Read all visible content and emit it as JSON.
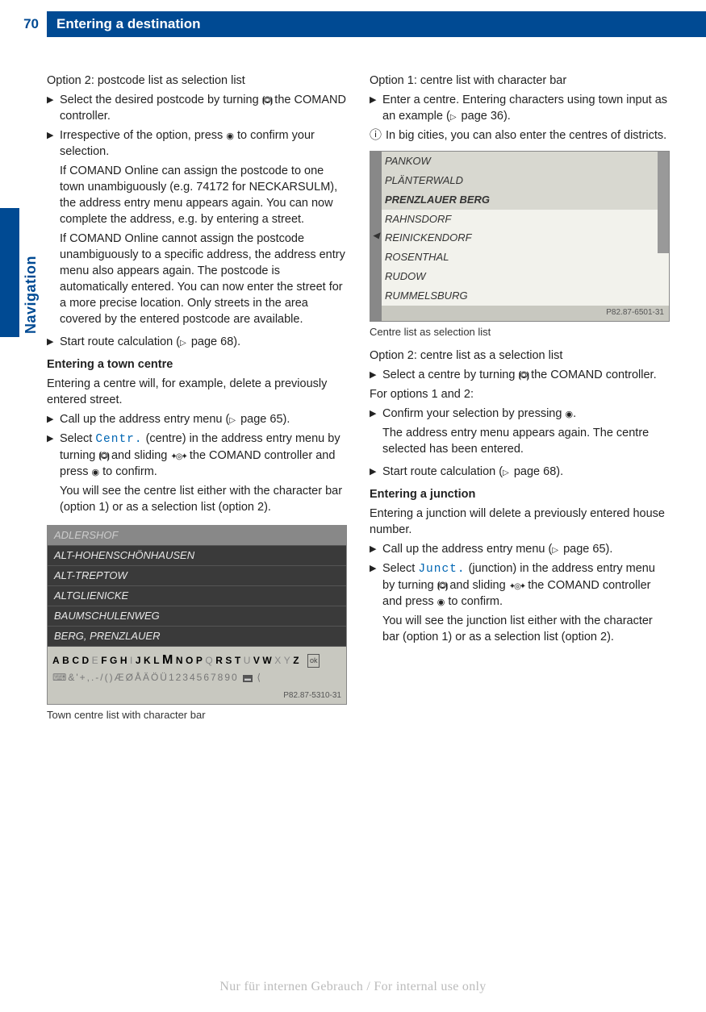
{
  "page_number": "70",
  "chapter": "Entering a destination",
  "side_label": "Navigation",
  "left": {
    "p1": "Option 2: postcode list as selection list",
    "s1": "Select the desired postcode by turning ",
    "s1b": " the COMAND controller.",
    "s2a": "Irrespective of the option, press ",
    "s2b": " to confirm your selection.",
    "s2c": "If COMAND Online can assign the postcode to one town unambiguously (e.g. 74172 for NECKARSULM), the address entry menu appears again. You can now complete the address, e.g. by entering a street.",
    "s2d": "If COMAND Online cannot assign the postcode unambiguously to a specific address, the address entry menu also appears again. The postcode is automatically entered. You can now enter the street for a more precise location. Only streets in the area covered by the entered postcode are available.",
    "s3": "Start route calculation (",
    "s3b": " page 68).",
    "h1": "Entering a town centre",
    "p2": "Entering a centre will, for example, delete a previously entered street.",
    "s4": "Call up the address entry menu (",
    "s4b": " page 65).",
    "s5a": "Select ",
    "s5menu": "Centr.",
    "s5b": " (centre) in the address entry menu by turning ",
    "s5c": " and sliding ",
    "s5d": " the COMAND controller and press ",
    "s5e": " to confirm.",
    "s5f": "You will see the centre list either with the character bar (option 1) or as a selection list (option 2).",
    "fig1": {
      "rows": [
        "ADLERSHOF",
        "ALT-HOHENSCHÖNHAUSEN",
        "ALT-TREPTOW",
        "ALTGLIENICKE",
        "BAUMSCHULENWEG",
        "BERG, PRENZLAUER"
      ],
      "bar1_pre": "ABCD",
      "bar1_hl1": "E",
      "bar1_mid": "FGH",
      "bar1_dim1": "I",
      "bar1_mid2": "JKL",
      "bar1_hl2": "M",
      "bar1_mid3": "NOP",
      "bar1_dim2": "Q",
      "bar1_mid4": "RST",
      "bar1_dim3": "U",
      "bar1_mid5": "VW",
      "bar1_dim4": "XY",
      "bar1_end": "Z",
      "ok": "ok",
      "bar2": "⌨&'+,.-/()ÆØÅÄÖÜ1234567890",
      "bar2_flag": "▬",
      "bar2_back": "⟨",
      "id": "P82.87-5310-31"
    },
    "cap1": "Town centre list with character bar"
  },
  "right": {
    "p1": "Option 1: centre list with character bar",
    "s1a": "Enter a centre. Entering characters using town input as an example (",
    "s1b": " page 36).",
    "info1": "In big cities, you can also enter the centres of districts.",
    "fig2": {
      "rows": [
        "PANKOW",
        "PLÄNTERWALD",
        "PRENZLAUER BERG",
        "RAHNSDORF",
        "REINICKENDORF",
        "ROSENTHAL",
        "RUDOW",
        "RUMMELSBURG"
      ],
      "id": "P82.87-6501-31"
    },
    "cap2": "Centre list as selection list",
    "p2": "Option 2: centre list as a selection list",
    "s2a": "Select a centre by turning ",
    "s2b": " the COMAND controller.",
    "p3": "For options 1 and 2:",
    "s3a": "Confirm your selection by pressing ",
    "s3b": ".",
    "s3c": "The address entry menu appears again. The centre selected has been entered.",
    "s4": "Start route calculation (",
    "s4b": " page 68).",
    "h2": "Entering a junction",
    "p4": "Entering a junction will delete a previously entered house number.",
    "s5": "Call up the address entry menu (",
    "s5b": " page 65).",
    "s6a": "Select ",
    "s6menu": "Junct.",
    "s6b": " (junction) in the address entry menu by turning ",
    "s6c": " and sliding ",
    "s6d": " the COMAND controller and press ",
    "s6e": " to confirm.",
    "s6f": "You will see the junction list either with the character bar (option 1) or as a selection list (option 2)."
  },
  "footer": "Nur für internen Gebrauch / For internal use only"
}
